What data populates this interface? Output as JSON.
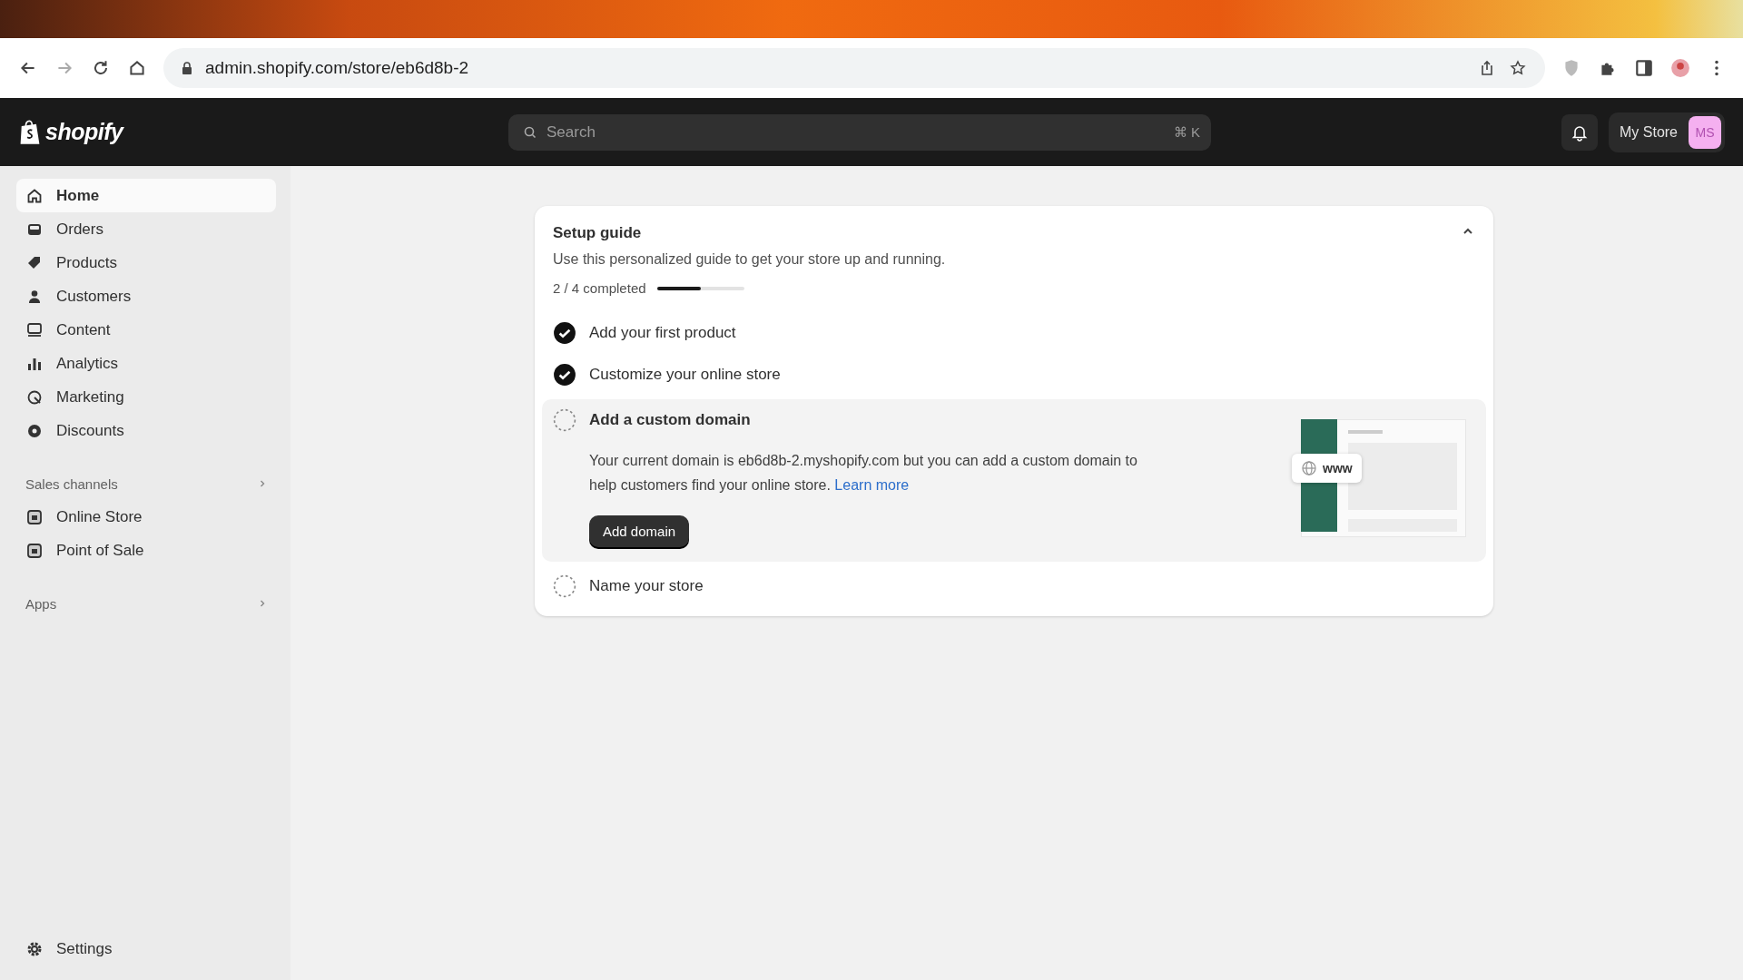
{
  "browser": {
    "url": "admin.shopify.com/store/eb6d8b-2"
  },
  "topbar": {
    "logo": "shopify",
    "search": {
      "placeholder": "Search",
      "shortcut": "⌘ K"
    },
    "store": "My Store",
    "avatar": "MS"
  },
  "sidebar": {
    "items": [
      {
        "label": "Home",
        "selected": true
      },
      {
        "label": "Orders",
        "selected": false
      },
      {
        "label": "Products",
        "selected": false
      },
      {
        "label": "Customers",
        "selected": false
      },
      {
        "label": "Content",
        "selected": false
      },
      {
        "label": "Analytics",
        "selected": false
      },
      {
        "label": "Marketing",
        "selected": false
      },
      {
        "label": "Discounts",
        "selected": false
      }
    ],
    "sections": [
      {
        "title": "Sales channels",
        "items": [
          {
            "label": "Online Store",
            "selected": false
          },
          {
            "label": "Point of Sale",
            "selected": false
          }
        ]
      },
      {
        "title": "Apps"
      }
    ],
    "settings": "Settings"
  },
  "setup_guide": {
    "title": "Setup guide",
    "description": "Use this personalized guide to get your store up and running.",
    "expanded": true,
    "progress_text": "2 / 4 completed",
    "level": 0.5,
    "tasks": [
      {
        "title": "Add your first product",
        "done": true,
        "expanded": false
      },
      {
        "title": "Customize your online store",
        "done": true,
        "expanded": false
      },
      {
        "title": "Add a custom domain",
        "done": false,
        "expanded": true,
        "description": "Your current domain is eb6d8b-2.myshopify.com but you can add a custom domain to help customers find your online store.",
        "link": "Learn more",
        "button": "Add domain",
        "illustration_text": "www"
      },
      {
        "title": "Name your store",
        "done": false,
        "expanded": false
      }
    ]
  }
}
